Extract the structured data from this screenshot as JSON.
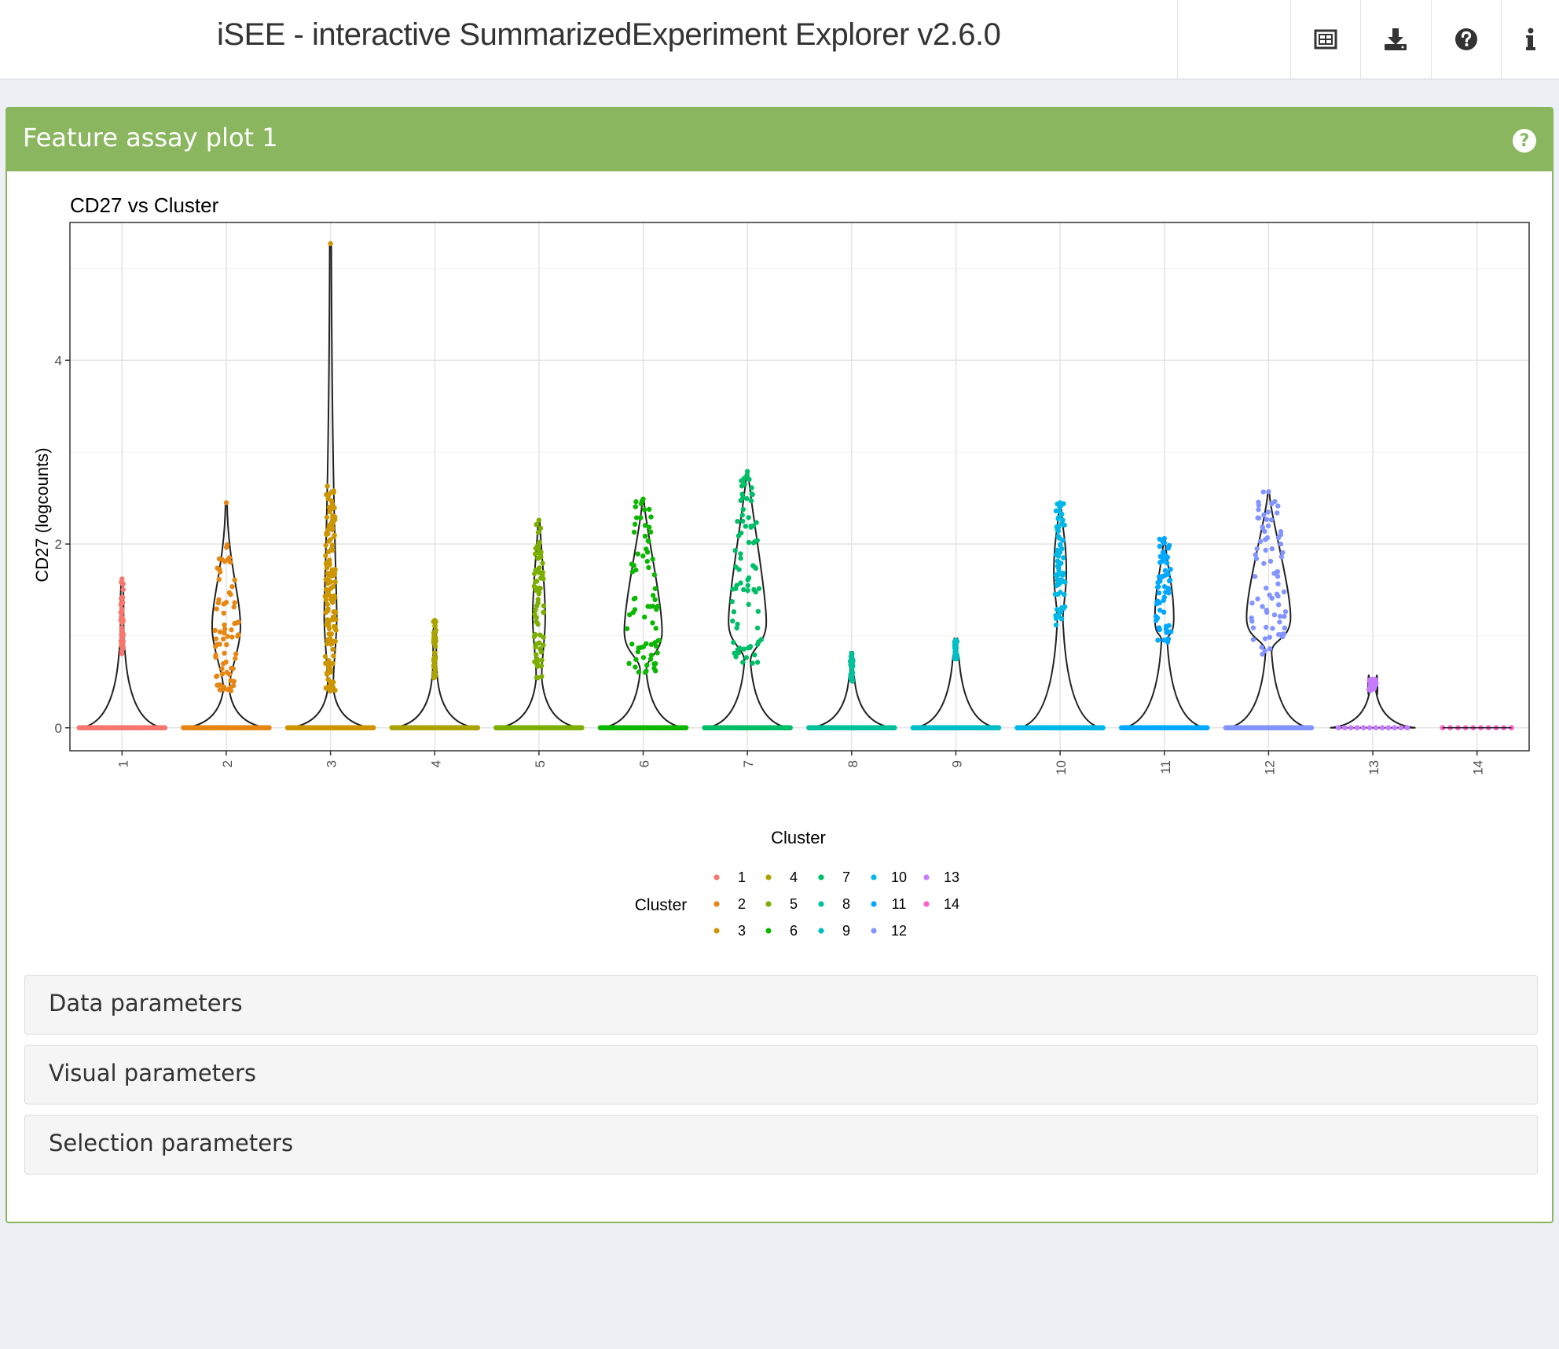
{
  "app": {
    "title": "iSEE - interactive SummarizedExperiment Explorer v2.6.0"
  },
  "toolbar": {
    "buttons": [
      {
        "name": "code-export-button",
        "icon": "table-icon"
      },
      {
        "name": "download-button",
        "icon": "download-icon"
      },
      {
        "name": "help-button",
        "icon": "question-circle-icon"
      },
      {
        "name": "info-button",
        "icon": "info-icon"
      }
    ]
  },
  "panel": {
    "title": "Feature assay plot 1",
    "header_color": "#8ab660",
    "help_icon": "question-circle-icon",
    "help_glyph": "?"
  },
  "sections": {
    "data": "Data parameters",
    "visual": "Visual parameters",
    "selection": "Selection parameters"
  },
  "chart_data": {
    "type": "violin",
    "title": "CD27 vs Cluster",
    "xlabel": "Cluster",
    "ylabel": "CD27 (logcounts)",
    "ylim": [
      -0.25,
      5.5
    ],
    "yticks": [
      0,
      2,
      4
    ],
    "grid": true,
    "legend": {
      "title": "Cluster",
      "position": "bottom",
      "ncol": 5
    },
    "categories": [
      "1",
      "2",
      "3",
      "4",
      "5",
      "6",
      "7",
      "8",
      "9",
      "10",
      "11",
      "12",
      "13",
      "14"
    ],
    "colors": [
      "#F8766D",
      "#E68613",
      "#CD9600",
      "#ABA300",
      "#7CAE00",
      "#0CB702",
      "#00BE67",
      "#00C19A",
      "#00BFC4",
      "#00B8E7",
      "#00A9FF",
      "#8494FF",
      "#C77CFF",
      "#FF61CC"
    ],
    "series": [
      {
        "name": "1",
        "max": 1.62,
        "bulk": [
          0.8,
          1.2,
          1.62
        ],
        "zeros": 40
      },
      {
        "name": "2",
        "max": 2.45,
        "bulk": [
          0.4,
          1.1,
          2.05
        ],
        "zeros": 45
      },
      {
        "name": "3",
        "max": 5.27,
        "bulk": [
          0.4,
          1.2,
          2.65
        ],
        "zeros": 45
      },
      {
        "name": "4",
        "max": 1.17,
        "bulk": [
          0.5,
          0.9,
          1.17
        ],
        "zeros": 45
      },
      {
        "name": "5",
        "max": 2.26,
        "bulk": [
          0.5,
          1.2,
          2.26
        ],
        "zeros": 45
      },
      {
        "name": "6",
        "max": 2.49,
        "bulk": [
          0.6,
          1.05,
          2.49
        ],
        "zeros": 45
      },
      {
        "name": "7",
        "max": 2.79,
        "bulk": [
          0.7,
          1.15,
          2.79
        ],
        "zeros": 45
      },
      {
        "name": "8",
        "max": 0.81,
        "bulk": [
          0.5,
          0.7,
          0.81
        ],
        "zeros": 45
      },
      {
        "name": "9",
        "max": 0.95,
        "bulk": [
          0.75,
          0.85,
          0.95
        ],
        "zeros": 45
      },
      {
        "name": "10",
        "max": 2.45,
        "bulk": [
          1.1,
          1.7,
          2.45
        ],
        "zeros": 45
      },
      {
        "name": "11",
        "max": 2.06,
        "bulk": [
          0.9,
          1.2,
          2.06
        ],
        "zeros": 45
      },
      {
        "name": "12",
        "max": 2.57,
        "bulk": [
          0.8,
          1.2,
          2.57
        ],
        "zeros": 45
      },
      {
        "name": "13",
        "max": 0.53,
        "bulk": [
          0.4,
          0.45,
          0.53
        ],
        "zeros": 12
      },
      {
        "name": "14",
        "max": 0.0,
        "bulk": [
          0,
          0,
          0
        ],
        "zeros": 10
      }
    ]
  }
}
